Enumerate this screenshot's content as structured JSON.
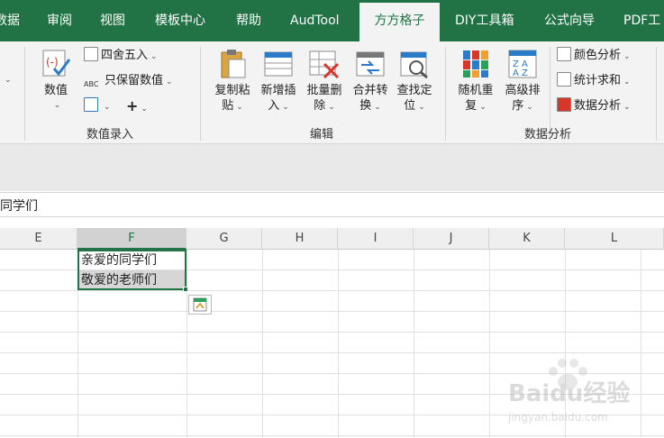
{
  "tabs": [
    {
      "label": "数据",
      "active": false
    },
    {
      "label": "审阅",
      "active": false
    },
    {
      "label": "视图",
      "active": false
    },
    {
      "label": "模板中心",
      "active": false
    },
    {
      "label": "帮助",
      "active": false
    },
    {
      "label": "AudTool",
      "active": false
    },
    {
      "label": "方方格子",
      "active": true
    },
    {
      "label": "DIY工具箱",
      "active": false
    },
    {
      "label": "公式向导",
      "active": false
    },
    {
      "label": "PDF工",
      "active": false
    }
  ],
  "ribbon": {
    "group_numeric": {
      "label": "数值录入",
      "value_button": "数值",
      "round_button": "四舍五入",
      "keep_numeric_button": "只保留数值",
      "plus_symbol": "+"
    },
    "group_edit": {
      "label": "编辑",
      "copy_paste": [
        "复制粘",
        "贴"
      ],
      "insert": [
        "新增插",
        "入"
      ],
      "bulk_delete": [
        "批量删",
        "除"
      ],
      "merge_convert": [
        "合并转",
        "换"
      ],
      "find_locate": [
        "查找定",
        "位"
      ]
    },
    "group_analysis": {
      "label": "数据分析",
      "random": [
        "随机重",
        "复"
      ],
      "advanced_sort": [
        "高级排",
        "序"
      ],
      "color_analysis": "颜色分析",
      "stat_sum": "统计求和",
      "data_analysis": "数据分析"
    }
  },
  "formula_bar": {
    "text": "同学们"
  },
  "columns": [
    "E",
    "F",
    "G",
    "H",
    "I",
    "J",
    "K",
    "L"
  ],
  "selected_column": "F",
  "cells": {
    "F1": "亲爱的同学们",
    "F2": "敬爱的老师们"
  },
  "watermark": {
    "brand": "Baidu经验",
    "url": "jingyan.baidu.com"
  },
  "colors": {
    "accent": "#217346",
    "ribbon": "#f3f3f3"
  }
}
